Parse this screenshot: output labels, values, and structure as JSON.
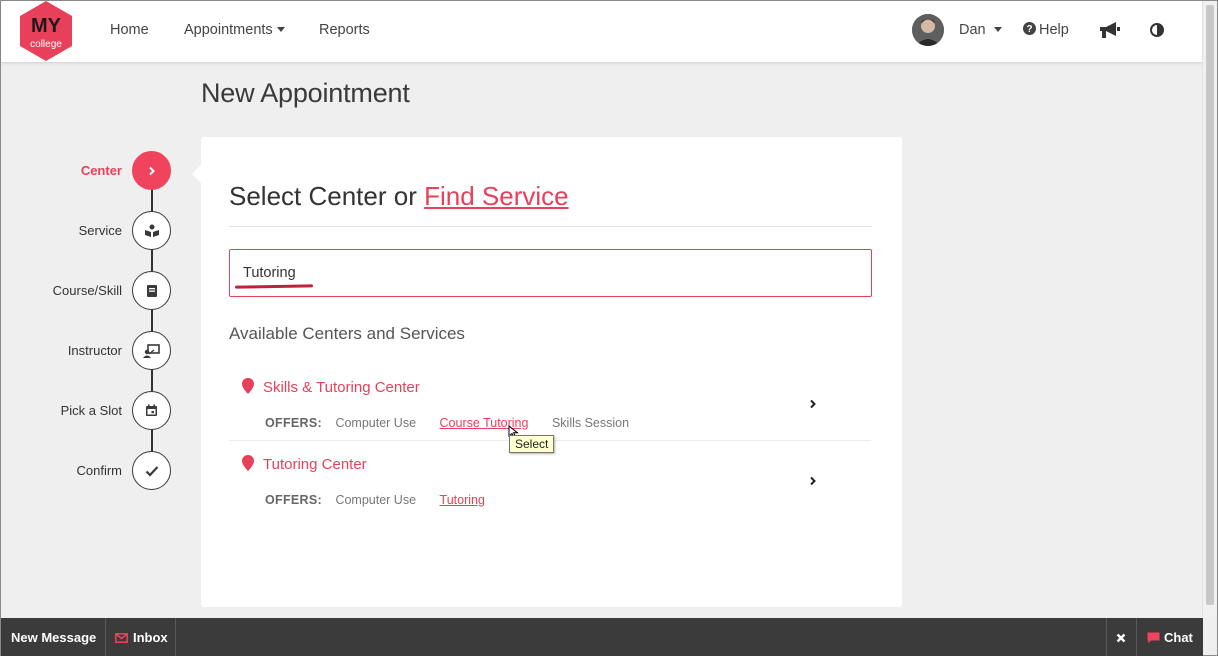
{
  "header": {
    "logo": {
      "top_text": "MY",
      "bottom_text": "college"
    },
    "nav": [
      {
        "label": "Home"
      },
      {
        "label": "Appointments"
      },
      {
        "label": "Reports"
      }
    ],
    "user_name": "Dan",
    "help_label": "Help",
    "icons": [
      "user-avatar",
      "chevron-down-icon",
      "question-circle-icon",
      "megaphone-icon",
      "contrast-icon"
    ]
  },
  "page": {
    "title": "New Appointment"
  },
  "stepper": {
    "steps": [
      {
        "label": "Center",
        "icon": "chevron-right-icon",
        "active": true
      },
      {
        "label": "Service",
        "icon": "service-icon",
        "active": false
      },
      {
        "label": "Course/Skill",
        "icon": "book-icon",
        "active": false
      },
      {
        "label": "Instructor",
        "icon": "presenter-icon",
        "active": false
      },
      {
        "label": "Pick a Slot",
        "icon": "calendar-icon",
        "active": false
      },
      {
        "label": "Confirm",
        "icon": "check-icon",
        "active": false
      }
    ]
  },
  "card": {
    "title_prefix": "Select Center or",
    "title_link": "Find Service",
    "search_value": "Tutoring",
    "section_heading": "Available Centers and Services",
    "offers_label": "OFFERS:",
    "centers": [
      {
        "name": "Skills & Tutoring Center",
        "offers": [
          {
            "label": "Computer Use",
            "link": false
          },
          {
            "label": "Course Tutoring",
            "link": true
          },
          {
            "label": "Skills Session",
            "link": false
          }
        ]
      },
      {
        "name": "Tutoring Center",
        "offers": [
          {
            "label": "Computer Use",
            "link": false
          },
          {
            "label": "Tutoring",
            "link": true
          }
        ]
      }
    ],
    "tooltip": "Select"
  },
  "bottombar": {
    "new_message": "New Message",
    "inbox": "Inbox",
    "chat": "Chat"
  },
  "colors": {
    "accent": "#e8405a",
    "bottombar": "#3b3b3b",
    "background": "#efefef"
  }
}
